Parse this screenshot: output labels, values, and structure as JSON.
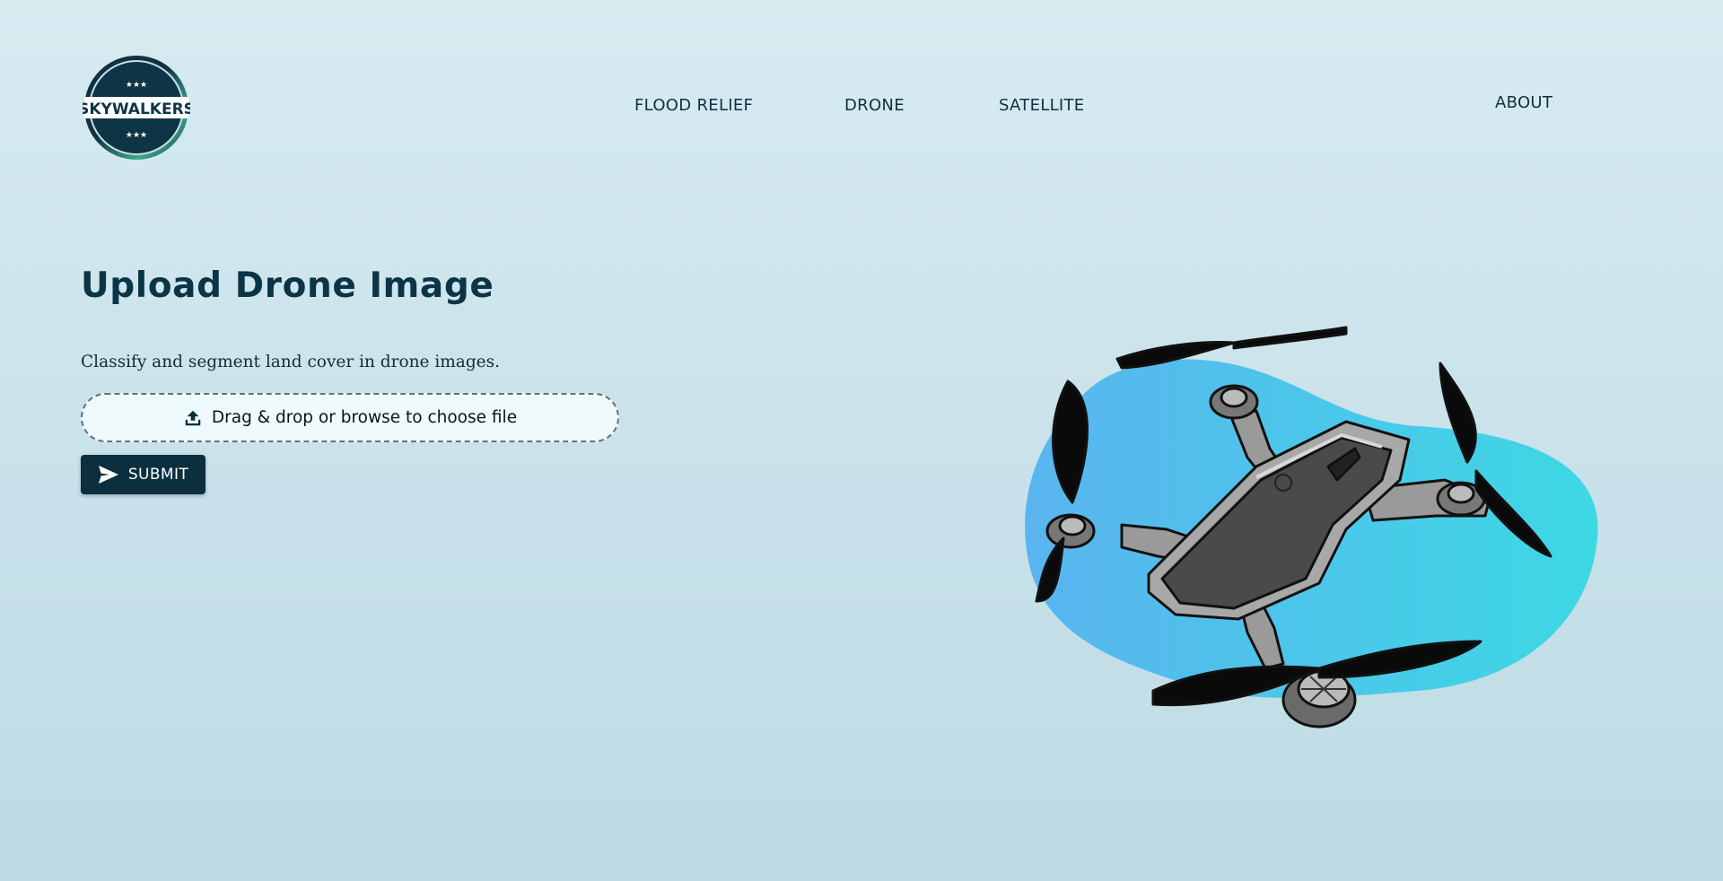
{
  "header": {
    "logo_text": "SKYWALKERS",
    "nav": {
      "flood_relief": "FLOOD RELIEF",
      "drone": "DRONE",
      "satellite": "SATELLITE",
      "about": "ABOUT"
    }
  },
  "main": {
    "title": "Upload Drone Image",
    "subtitle": "Classify and segment land cover in drone images.",
    "dropzone_label": "Drag & drop or browse to choose file",
    "submit_label": "SUBMIT"
  },
  "icons": {
    "upload": "upload-icon",
    "submit": "send-icon",
    "logo": "skywalkers-logo",
    "illustration": "drone-illustration"
  },
  "colors": {
    "background": "#d2e8ef",
    "primary": "#0b2f3f",
    "dropzone_bg": "#eefafc",
    "blob_start": "#5ab4ef",
    "blob_end": "#3dd8e4"
  }
}
